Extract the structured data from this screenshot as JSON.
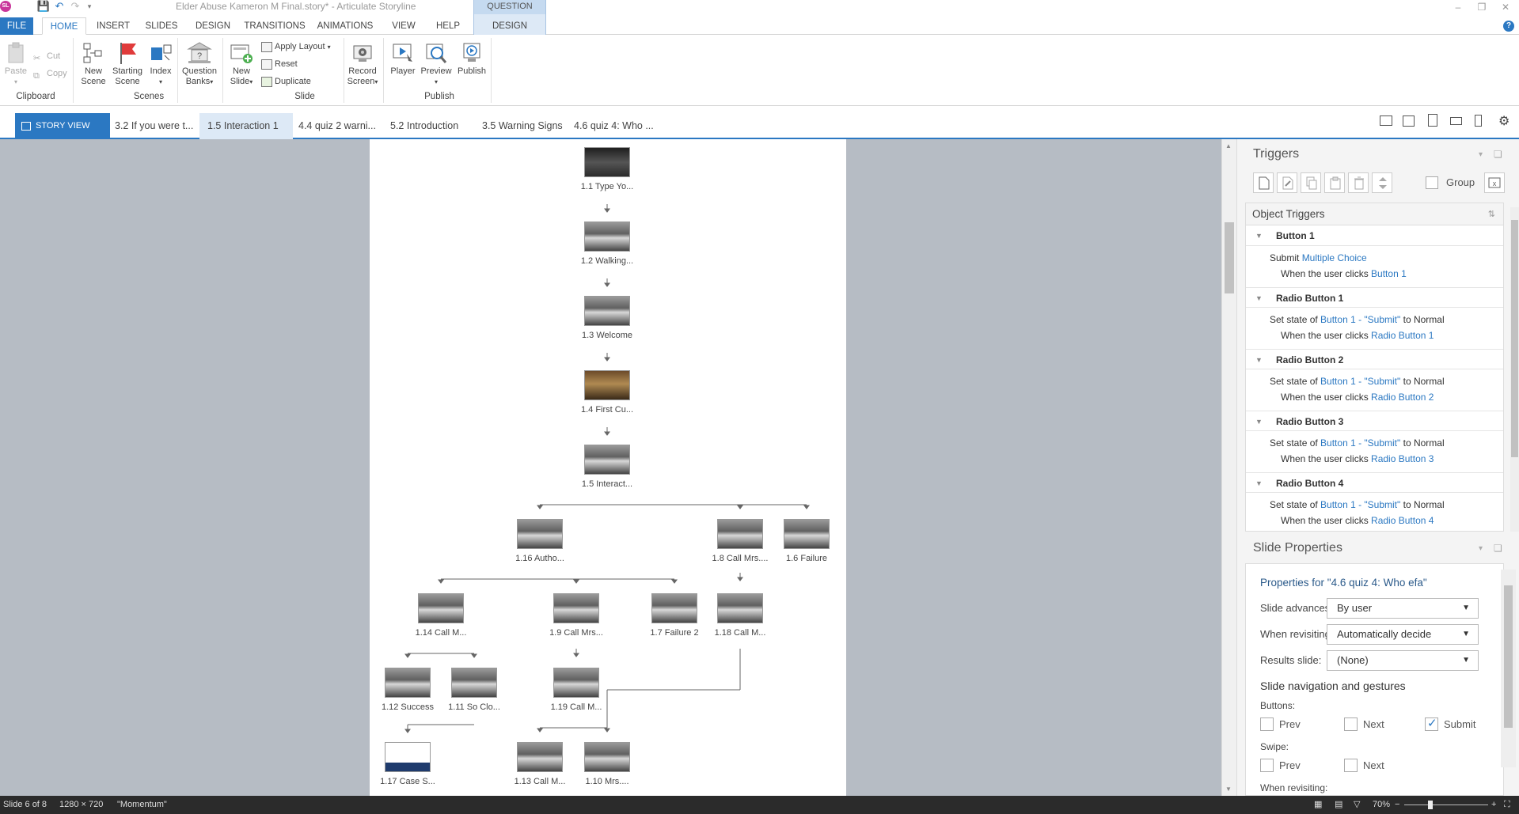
{
  "window": {
    "app_logo": "SL",
    "title": "Elder Abuse Kameron M Final.story* - Articulate Storyline",
    "contextual_header": "QUESTION TOOLS"
  },
  "tabs": [
    {
      "label": "FILE"
    },
    {
      "label": "HOME"
    },
    {
      "label": "INSERT"
    },
    {
      "label": "SLIDES"
    },
    {
      "label": "DESIGN"
    },
    {
      "label": "TRANSITIONS"
    },
    {
      "label": "ANIMATIONS"
    },
    {
      "label": "VIEW"
    },
    {
      "label": "HELP"
    },
    {
      "label": "DESIGN"
    }
  ],
  "ribbon": {
    "clipboard": {
      "paste": "Paste",
      "cut": "Cut",
      "copy": "Copy",
      "label": "Clipboard"
    },
    "scenes": {
      "new_scene": [
        "New",
        "Scene"
      ],
      "starting_scene": [
        "Starting",
        "Scene"
      ],
      "index": "Index",
      "label": "Scenes"
    },
    "question_banks": [
      "Question",
      "Banks"
    ],
    "slide": {
      "new_slide": [
        "New",
        "Slide"
      ],
      "apply_layout": "Apply Layout",
      "reset": "Reset",
      "duplicate": "Duplicate",
      "label": "Slide"
    },
    "record_screen": [
      "Record",
      "Screen"
    ],
    "publish": {
      "player": "Player",
      "preview": "Preview",
      "publish": "Publish",
      "label": "Publish"
    }
  },
  "view_tabs": {
    "story_view": "STORY VIEW",
    "slides": [
      {
        "label": "3.2 If you were t..."
      },
      {
        "label": "1.5 Interaction 1"
      },
      {
        "label": "4.4 quiz 2 warni..."
      },
      {
        "label": "5.2 Introduction"
      },
      {
        "label": "3.5 Warning Signs"
      },
      {
        "label": "4.6 quiz 4: Who ..."
      }
    ]
  },
  "story_nodes": [
    {
      "label": "1.1 Type Yo...",
      "thumb": "dark"
    },
    {
      "label": "1.2 Walking...",
      "thumb": "gray"
    },
    {
      "label": "1.3 Welcome",
      "thumb": "gray"
    },
    {
      "label": "1.4 First Cu...",
      "thumb": "brown"
    },
    {
      "label": "1.5 Interact...",
      "thumb": "gray"
    },
    {
      "label": "1.16 Autho...",
      "thumb": "gray"
    },
    {
      "label": "1.8 Call Mrs....",
      "thumb": "gray"
    },
    {
      "label": "1.6 Failure",
      "thumb": "gray"
    },
    {
      "label": "1.14 Call M...",
      "thumb": "gray"
    },
    {
      "label": "1.9 Call Mrs...",
      "thumb": "gray"
    },
    {
      "label": "1.7 Failure 2",
      "thumb": "gray"
    },
    {
      "label": "1.18 Call M...",
      "thumb": "gray"
    },
    {
      "label": "1.12 Success",
      "thumb": "gray"
    },
    {
      "label": "1.11 So Clo...",
      "thumb": "gray"
    },
    {
      "label": "1.19 Call M...",
      "thumb": "gray"
    },
    {
      "label": "1.17 Case S...",
      "thumb": "doc"
    },
    {
      "label": "1.13 Call M...",
      "thumb": "gray"
    },
    {
      "label": "1.10 Mrs....",
      "thumb": "gray"
    }
  ],
  "triggers_panel": {
    "title": "Triggers",
    "group_label": "Group",
    "object_triggers_title": "Object Triggers",
    "groups": [
      {
        "name": "Button 1",
        "action": [
          "Submit ",
          "Multiple Choice",
          ""
        ],
        "when": [
          "When the ",
          "user",
          " clicks ",
          "Button 1"
        ]
      },
      {
        "name": "Radio Button 1",
        "action": [
          "Set state of ",
          "Button 1 - \"Submit\"",
          " to ",
          "Normal"
        ],
        "when": [
          "When the ",
          "user",
          " clicks ",
          "Radio Button 1"
        ]
      },
      {
        "name": "Radio Button 2",
        "action": [
          "Set state of ",
          "Button 1 - \"Submit\"",
          " to ",
          "Normal"
        ],
        "when": [
          "When the ",
          "user",
          " clicks ",
          "Radio Button 2"
        ]
      },
      {
        "name": "Radio Button 3",
        "action": [
          "Set state of ",
          "Button 1 - \"Submit\"",
          " to ",
          "Normal"
        ],
        "when": [
          "When the ",
          "user",
          " clicks ",
          "Radio Button 3"
        ]
      },
      {
        "name": "Radio Button 4",
        "action": [
          "Set state of ",
          "Button 1 - \"Submit\"",
          " to ",
          "Normal"
        ],
        "when": [
          "When the ",
          "user",
          " clicks ",
          "Radio Button 4"
        ]
      }
    ]
  },
  "slide_properties": {
    "title": "Slide Properties",
    "properties_for": "Properties for \"4.6 quiz 4: Who efa\"",
    "slide_advances_label": "Slide advances:",
    "slide_advances_value": "By user",
    "when_revisiting_label": "When revisiting:",
    "when_revisiting_value": "Automatically decide",
    "results_slide_label": "Results slide:",
    "results_slide_value": "(None)",
    "nav_heading": "Slide navigation and gestures",
    "buttons_label": "Buttons:",
    "buttons": [
      {
        "label": "Prev",
        "checked": false
      },
      {
        "label": "Next",
        "checked": false
      },
      {
        "label": "Submit",
        "checked": true
      }
    ],
    "swipe_label": "Swipe:",
    "swipe": [
      {
        "label": "Prev",
        "checked": false
      },
      {
        "label": "Next",
        "checked": false
      }
    ],
    "when_revisiting_cut": "When revisiting:"
  },
  "status": {
    "slide": "Slide 6 of 8",
    "size": "1280 × 720",
    "theme": "\"Momentum\"",
    "zoom": "70%"
  },
  "colors": {
    "accent": "#2b78c2",
    "canvas_bg": "#b6bcc4",
    "status_bg": "#2b2b2b"
  }
}
